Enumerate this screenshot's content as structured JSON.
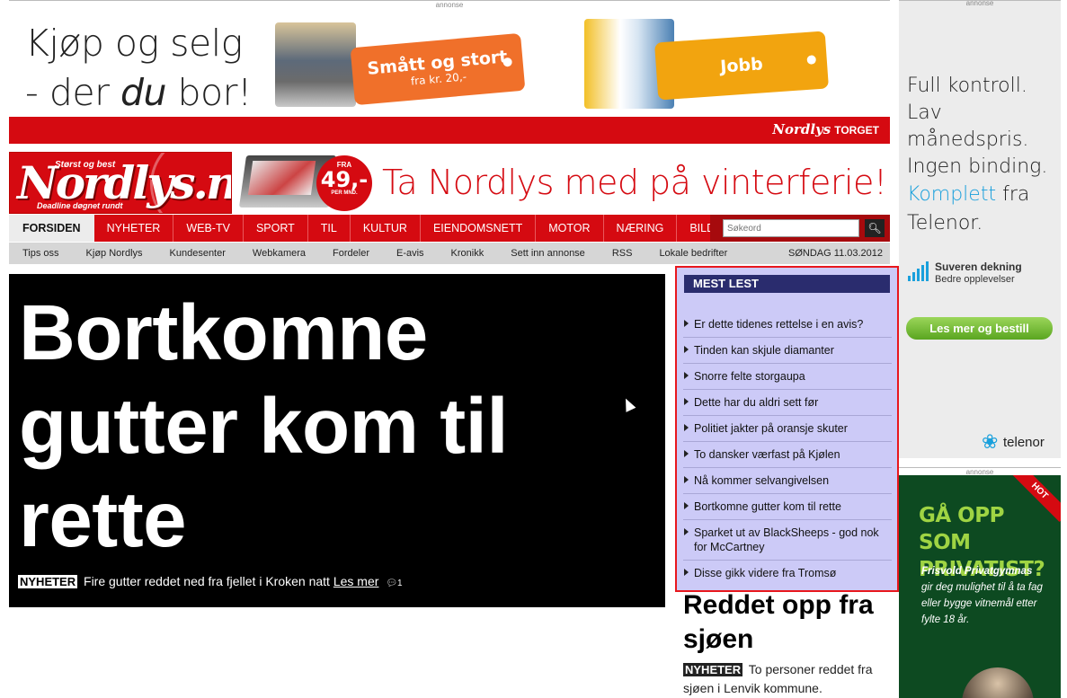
{
  "top_ad": {
    "label": "annonse",
    "slogan_line1": "Kjøp og selg",
    "slogan_line2_pre": "- der ",
    "slogan_line2_em": "du",
    "slogan_line2_post": " bor!",
    "tag_small_title": "Smått og stort",
    "tag_small_sub": "fra kr. 20,-",
    "tag_job": "Jobb",
    "torget_logo": "Nordlys",
    "torget_word": "TORGET"
  },
  "header": {
    "logo_tagline": "Størst og best",
    "logo_name": "Nordlys.no",
    "logo_subtag": "Deadline døgnet rundt",
    "promo_badge_from": "FRA",
    "promo_badge_price": "49,-",
    "promo_badge_per": "PER MND.",
    "promo_headline": "Ta Nordlys med på vinterferie!"
  },
  "nav": {
    "items": [
      "FORSIDEN",
      "NYHETER",
      "WEB-TV",
      "SPORT",
      "TIL",
      "KULTUR",
      "EIENDOMSNETT",
      "MOTOR",
      "NÆRING",
      "BILDER"
    ],
    "search_placeholder": "Søkeord"
  },
  "subnav": {
    "items": [
      "Tips oss",
      "Kjøp Nordlys",
      "Kundesenter",
      "Webkamera",
      "Fordeler",
      "E-avis",
      "Kronikk",
      "Sett inn annonse",
      "RSS",
      "Lokale bedrifter"
    ],
    "date": "SØNDAG 11.03.2012"
  },
  "main_story": {
    "title": "Bortkomne gutter kom til rette",
    "kicker": "NYHETER",
    "summary": "Fire gutter reddet ned fra fjellet i Kroken natt",
    "read_more": "Les mer",
    "comments": "1"
  },
  "most_read": {
    "title": "MEST LEST",
    "items": [
      "Er dette tidenes rettelse i en avis?",
      "Tinden kan skjule diamanter",
      "Snorre felte storgaupa",
      "Dette har du aldri sett før",
      "Politiet jakter på oransje skuter",
      "To dansker værfast på Kjølen",
      "Nå kommer selvangivelsen",
      "Bortkomne gutter kom til rette",
      "Sparket ut av BlackSheeps - god nok for McCartney",
      "Disse gikk videre fra Tromsø"
    ]
  },
  "second_story": {
    "title": "Reddet opp fra sjøen",
    "kicker": "NYHETER",
    "summary": "To personer reddet fra sjøen i Lenvik kommune."
  },
  "right_ad1": {
    "label": "annonse",
    "line1": "Full kontroll.",
    "line2": "Lav månedspris.",
    "line3": "Ingen binding.",
    "brand_word": "Komplett",
    "line4_rest": " fra",
    "line5": "Telenor.",
    "coverage_title": "Suveren dekning",
    "coverage_sub": "Bedre opplevelser",
    "button": "Les mer og bestill",
    "logo": "telenor"
  },
  "right_ad2": {
    "label": "annonse",
    "hot": "HOT",
    "headline_line1": "GÅ OPP SOM",
    "headline_line2": "PRIVATIST?",
    "body_bold": "Frisvold Privatgymnas",
    "body": "gir deg mulighet til å ta fag eller bygge vitnemål etter fylte 18 år."
  },
  "colors": {
    "brand_red": "#d50a11",
    "mostread_bg": "#cccaf7",
    "mostread_head": "#2a2c6e",
    "telenor_blue": "#1aa0dc",
    "privatist_green": "#0d4a21"
  }
}
